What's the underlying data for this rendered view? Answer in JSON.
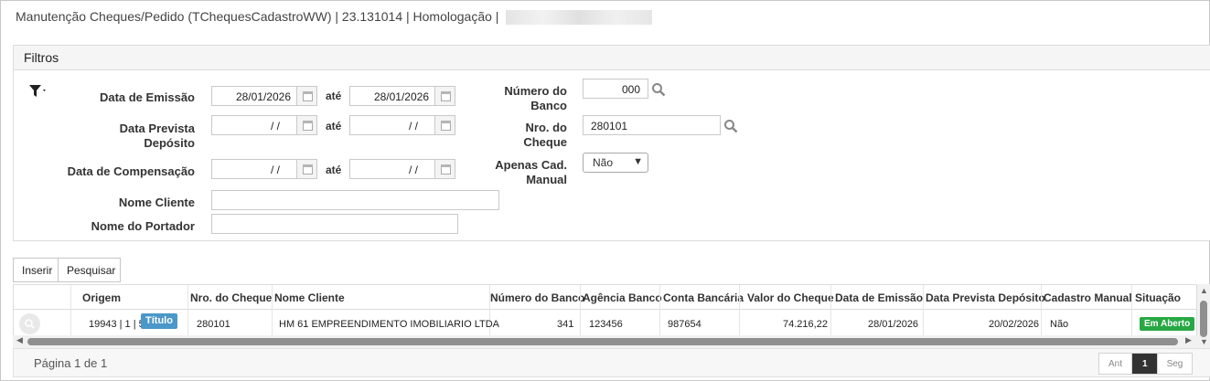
{
  "window": {
    "title": "Manutenção Cheques/Pedido (TChequesCadastroWW) | 23.131014 | Homologação |"
  },
  "filters": {
    "title": "Filtros",
    "data_emissao_label": "Data de Emissão",
    "data_emissao_de": "28/01/2026",
    "data_emissao_ate": "28/01/2026",
    "data_prevista_label": "Data Prevista Depósito",
    "data_prevista_de": "/ /",
    "data_prevista_ate": "/ /",
    "data_compensacao_label": "Data de Compensação",
    "data_compensacao_de": "/ /",
    "data_compensacao_ate": "/ /",
    "ate_label": "até",
    "nome_cliente_label": "Nome Cliente",
    "nome_cliente_value": "",
    "nome_portador_label": "Nome do Portador",
    "nome_portador_value": "",
    "numero_banco_label": "Número do Banco",
    "numero_banco_value": "000",
    "nro_cheque_label": "Nro. do Cheque",
    "nro_cheque_value": "280101",
    "apenas_cad_label": "Apenas Cad. Manual",
    "apenas_cad_value": "Não"
  },
  "toolbar": {
    "inserir": "Inserir",
    "pesquisar": "Pesquisar"
  },
  "table": {
    "headers": {
      "origem": "Origem",
      "nro_cheque": "Nro. do Cheque",
      "nome_cliente": "Nome Cliente",
      "numero_banco": "Número do Banco",
      "agencia": "Agência Banco",
      "conta": "Conta Bancária",
      "valor": "Valor do Cheque",
      "data_emissao": "Data de Emissão",
      "data_prevista": "Data Prevista Depósito",
      "cadastro_manual": "Cadastro Manual",
      "situacao": "Situação"
    },
    "rows": [
      {
        "origem": "19943 | 1 | 5",
        "origem_badge": "Título",
        "nro_cheque": "280101",
        "nome_cliente": "HM 61 EMPREENDIMENTO IMOBILIARIO LTDA",
        "numero_banco": "341",
        "agencia": "123456",
        "conta": "987654",
        "valor": "74.216,22",
        "data_emissao": "28/01/2026",
        "data_prevista": "20/02/2026",
        "cadastro_manual": "Não",
        "situacao": "Em Aberto"
      }
    ]
  },
  "footer": {
    "page_info": "Página 1 de 1",
    "prev": "Ant",
    "current": "1",
    "next": "Seg"
  },
  "colors": {
    "badge_titulo": "#4a97c9",
    "badge_aberto": "#27a844"
  }
}
